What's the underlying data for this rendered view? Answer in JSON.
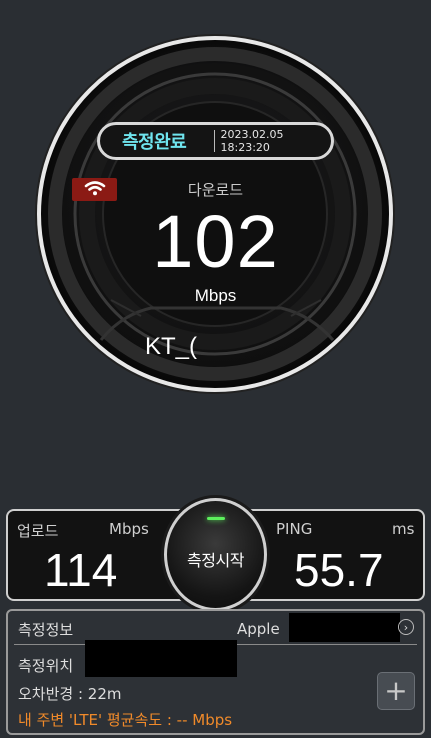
{
  "result": {
    "status": "측정완료",
    "timestamp": "2023.02.05 18:23:20",
    "download_label": "다운로드",
    "download_value": "102",
    "download_unit": "Mbps",
    "carrier": "KT_("
  },
  "stats": {
    "upload_label": "업로드",
    "upload_unit": "Mbps",
    "upload_value": "114",
    "ping_label": "PING",
    "ping_unit": "ms",
    "ping_value": "55.7",
    "start_button": "측정시작"
  },
  "info": {
    "title": "측정정보",
    "device": "Apple",
    "location_label": "측정위치",
    "error_radius": "오차반경 : 22m",
    "nearby_average": "내 주변 'LTE' 평균속도 : -- Mbps"
  },
  "icons": {
    "wifi": "wifi-icon",
    "chevron": "chevron-right-icon",
    "plus": "plus-icon"
  },
  "colors": {
    "background": "#2a2e33",
    "status_accent": "#6fe4ee",
    "wifi_badge": "#8b1a14",
    "indicator": "#5cf05c",
    "nearby_average": "#f08a2a"
  }
}
